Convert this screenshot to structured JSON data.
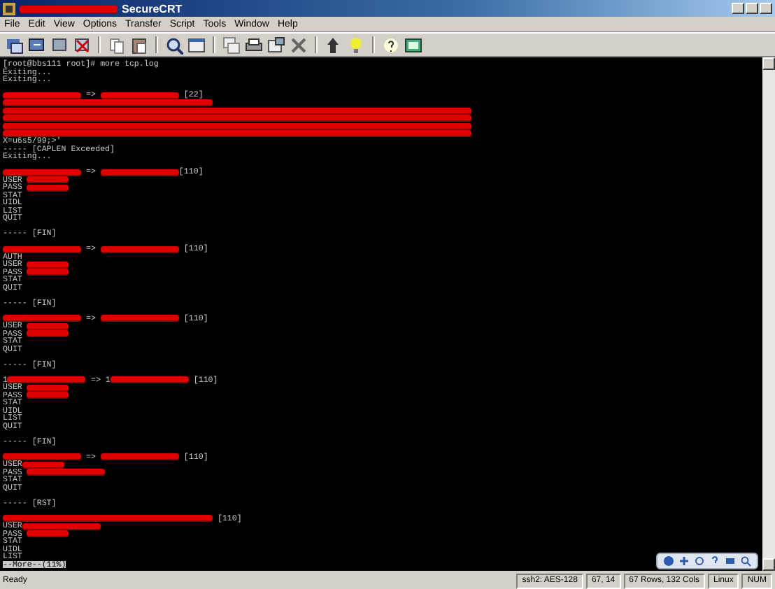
{
  "window": {
    "title": "SecureCRT",
    "title_redacted": true
  },
  "menu": [
    "File",
    "Edit",
    "View",
    "Options",
    "Transfer",
    "Script",
    "Tools",
    "Window",
    "Help"
  ],
  "terminal": {
    "lines": [
      {
        "kind": "text",
        "segments": [
          {
            "kind": "text",
            "text": "[root@bbs111 root]# more tcp.log"
          }
        ]
      },
      {
        "kind": "text",
        "segments": [
          {
            "kind": "text",
            "text": "Exiting..."
          }
        ]
      },
      {
        "kind": "text",
        "segments": [
          {
            "kind": "text",
            "text": "Exiting..."
          }
        ]
      },
      {
        "kind": "blank"
      },
      {
        "kind": "text",
        "segments": [
          {
            "kind": "redacted"
          },
          {
            "kind": "text",
            "text": " => "
          },
          {
            "kind": "redacted"
          },
          {
            "kind": "text",
            "text": " [22]"
          }
        ]
      },
      {
        "kind": "text",
        "segments": [
          {
            "kind": "redacted_wide"
          }
        ]
      },
      {
        "kind": "text",
        "segments": [
          {
            "kind": "redacted_line"
          }
        ]
      },
      {
        "kind": "text",
        "segments": [
          {
            "kind": "redacted_line"
          }
        ]
      },
      {
        "kind": "text",
        "segments": [
          {
            "kind": "redacted_line"
          }
        ]
      },
      {
        "kind": "text",
        "segments": [
          {
            "kind": "redacted_line"
          }
        ]
      },
      {
        "kind": "text",
        "segments": [
          {
            "kind": "text",
            "text": "X=u6s5/99;>'"
          }
        ]
      },
      {
        "kind": "text",
        "segments": [
          {
            "kind": "text",
            "text": "----- [CAPLEN Exceeded]"
          }
        ]
      },
      {
        "kind": "text",
        "segments": [
          {
            "kind": "text",
            "text": "Exiting..."
          }
        ]
      },
      {
        "kind": "blank"
      },
      {
        "kind": "text",
        "segments": [
          {
            "kind": "redacted"
          },
          {
            "kind": "text",
            "text": " => "
          },
          {
            "kind": "redacted"
          },
          {
            "kind": "text",
            "text": "[110]"
          }
        ]
      },
      {
        "kind": "text",
        "segments": [
          {
            "kind": "text",
            "text": "USER "
          },
          {
            "kind": "redacted_short"
          }
        ]
      },
      {
        "kind": "text",
        "segments": [
          {
            "kind": "text",
            "text": "PASS "
          },
          {
            "kind": "redacted_short"
          }
        ]
      },
      {
        "kind": "text",
        "segments": [
          {
            "kind": "text",
            "text": "STAT"
          }
        ]
      },
      {
        "kind": "text",
        "segments": [
          {
            "kind": "text",
            "text": "UIDL"
          }
        ]
      },
      {
        "kind": "text",
        "segments": [
          {
            "kind": "text",
            "text": "LIST"
          }
        ]
      },
      {
        "kind": "text",
        "segments": [
          {
            "kind": "text",
            "text": "QUIT"
          }
        ]
      },
      {
        "kind": "blank"
      },
      {
        "kind": "text",
        "segments": [
          {
            "kind": "text",
            "text": "----- [FIN]"
          }
        ]
      },
      {
        "kind": "blank"
      },
      {
        "kind": "text",
        "segments": [
          {
            "kind": "redacted"
          },
          {
            "kind": "text",
            "text": " => "
          },
          {
            "kind": "redacted"
          },
          {
            "kind": "text",
            "text": " [110]"
          }
        ]
      },
      {
        "kind": "text",
        "segments": [
          {
            "kind": "text",
            "text": "AUTH"
          }
        ]
      },
      {
        "kind": "text",
        "segments": [
          {
            "kind": "text",
            "text": "USER "
          },
          {
            "kind": "redacted_short"
          }
        ]
      },
      {
        "kind": "text",
        "segments": [
          {
            "kind": "text",
            "text": "PASS "
          },
          {
            "kind": "redacted_short"
          }
        ]
      },
      {
        "kind": "text",
        "segments": [
          {
            "kind": "text",
            "text": "STAT"
          }
        ]
      },
      {
        "kind": "text",
        "segments": [
          {
            "kind": "text",
            "text": "QUIT"
          }
        ]
      },
      {
        "kind": "blank"
      },
      {
        "kind": "text",
        "segments": [
          {
            "kind": "text",
            "text": "----- [FIN]"
          }
        ]
      },
      {
        "kind": "blank"
      },
      {
        "kind": "text",
        "segments": [
          {
            "kind": "redacted"
          },
          {
            "kind": "text",
            "text": " => "
          },
          {
            "kind": "redacted"
          },
          {
            "kind": "text",
            "text": " [110]"
          }
        ]
      },
      {
        "kind": "text",
        "segments": [
          {
            "kind": "text",
            "text": "USER "
          },
          {
            "kind": "redacted_short"
          }
        ]
      },
      {
        "kind": "text",
        "segments": [
          {
            "kind": "text",
            "text": "PASS "
          },
          {
            "kind": "redacted_short"
          }
        ]
      },
      {
        "kind": "text",
        "segments": [
          {
            "kind": "text",
            "text": "STAT"
          }
        ]
      },
      {
        "kind": "text",
        "segments": [
          {
            "kind": "text",
            "text": "QUIT"
          }
        ]
      },
      {
        "kind": "blank"
      },
      {
        "kind": "text",
        "segments": [
          {
            "kind": "text",
            "text": "----- [FIN]"
          }
        ]
      },
      {
        "kind": "blank"
      },
      {
        "kind": "text",
        "segments": [
          {
            "kind": "text",
            "text": "1"
          },
          {
            "kind": "redacted"
          },
          {
            "kind": "text",
            "text": " => 1"
          },
          {
            "kind": "redacted"
          },
          {
            "kind": "text",
            "text": " [110]"
          }
        ]
      },
      {
        "kind": "text",
        "segments": [
          {
            "kind": "text",
            "text": "USER "
          },
          {
            "kind": "redacted_short"
          }
        ]
      },
      {
        "kind": "text",
        "segments": [
          {
            "kind": "text",
            "text": "PASS "
          },
          {
            "kind": "redacted_short"
          }
        ]
      },
      {
        "kind": "text",
        "segments": [
          {
            "kind": "text",
            "text": "STAT"
          }
        ]
      },
      {
        "kind": "text",
        "segments": [
          {
            "kind": "text",
            "text": "UIDL"
          }
        ]
      },
      {
        "kind": "text",
        "segments": [
          {
            "kind": "text",
            "text": "LIST"
          }
        ]
      },
      {
        "kind": "text",
        "segments": [
          {
            "kind": "text",
            "text": "QUIT"
          }
        ]
      },
      {
        "kind": "blank"
      },
      {
        "kind": "text",
        "segments": [
          {
            "kind": "text",
            "text": "----- [FIN]"
          }
        ]
      },
      {
        "kind": "blank"
      },
      {
        "kind": "text",
        "segments": [
          {
            "kind": "redacted"
          },
          {
            "kind": "text",
            "text": " => "
          },
          {
            "kind": "redacted"
          },
          {
            "kind": "text",
            "text": " [110]"
          }
        ]
      },
      {
        "kind": "text",
        "segments": [
          {
            "kind": "text",
            "text": "USER"
          },
          {
            "kind": "redacted_short"
          }
        ]
      },
      {
        "kind": "text",
        "segments": [
          {
            "kind": "text",
            "text": "PASS "
          },
          {
            "kind": "redacted"
          }
        ]
      },
      {
        "kind": "text",
        "segments": [
          {
            "kind": "text",
            "text": "STAT"
          }
        ]
      },
      {
        "kind": "text",
        "segments": [
          {
            "kind": "text",
            "text": "QUIT"
          }
        ]
      },
      {
        "kind": "blank"
      },
      {
        "kind": "text",
        "segments": [
          {
            "kind": "text",
            "text": "----- [RST]"
          }
        ]
      },
      {
        "kind": "blank"
      },
      {
        "kind": "text",
        "segments": [
          {
            "kind": "redacted_wide"
          },
          {
            "kind": "text",
            "text": " [110]"
          }
        ]
      },
      {
        "kind": "text",
        "segments": [
          {
            "kind": "text",
            "text": "USER"
          },
          {
            "kind": "redacted"
          }
        ]
      },
      {
        "kind": "text",
        "segments": [
          {
            "kind": "text",
            "text": "PASS "
          },
          {
            "kind": "redacted_short"
          }
        ]
      },
      {
        "kind": "text",
        "segments": [
          {
            "kind": "text",
            "text": "STAT"
          }
        ]
      },
      {
        "kind": "text",
        "segments": [
          {
            "kind": "text",
            "text": "UIDL"
          }
        ]
      },
      {
        "kind": "text",
        "segments": [
          {
            "kind": "text",
            "text": "LIST"
          }
        ]
      },
      {
        "kind": "prompt",
        "text": "--More--(11%)"
      }
    ]
  },
  "status_bar": {
    "message": "Ready",
    "fields": [
      "ssh2: AES-128",
      "67, 14",
      "67 Rows, 132 Cols",
      "Linux",
      "NUM"
    ]
  }
}
